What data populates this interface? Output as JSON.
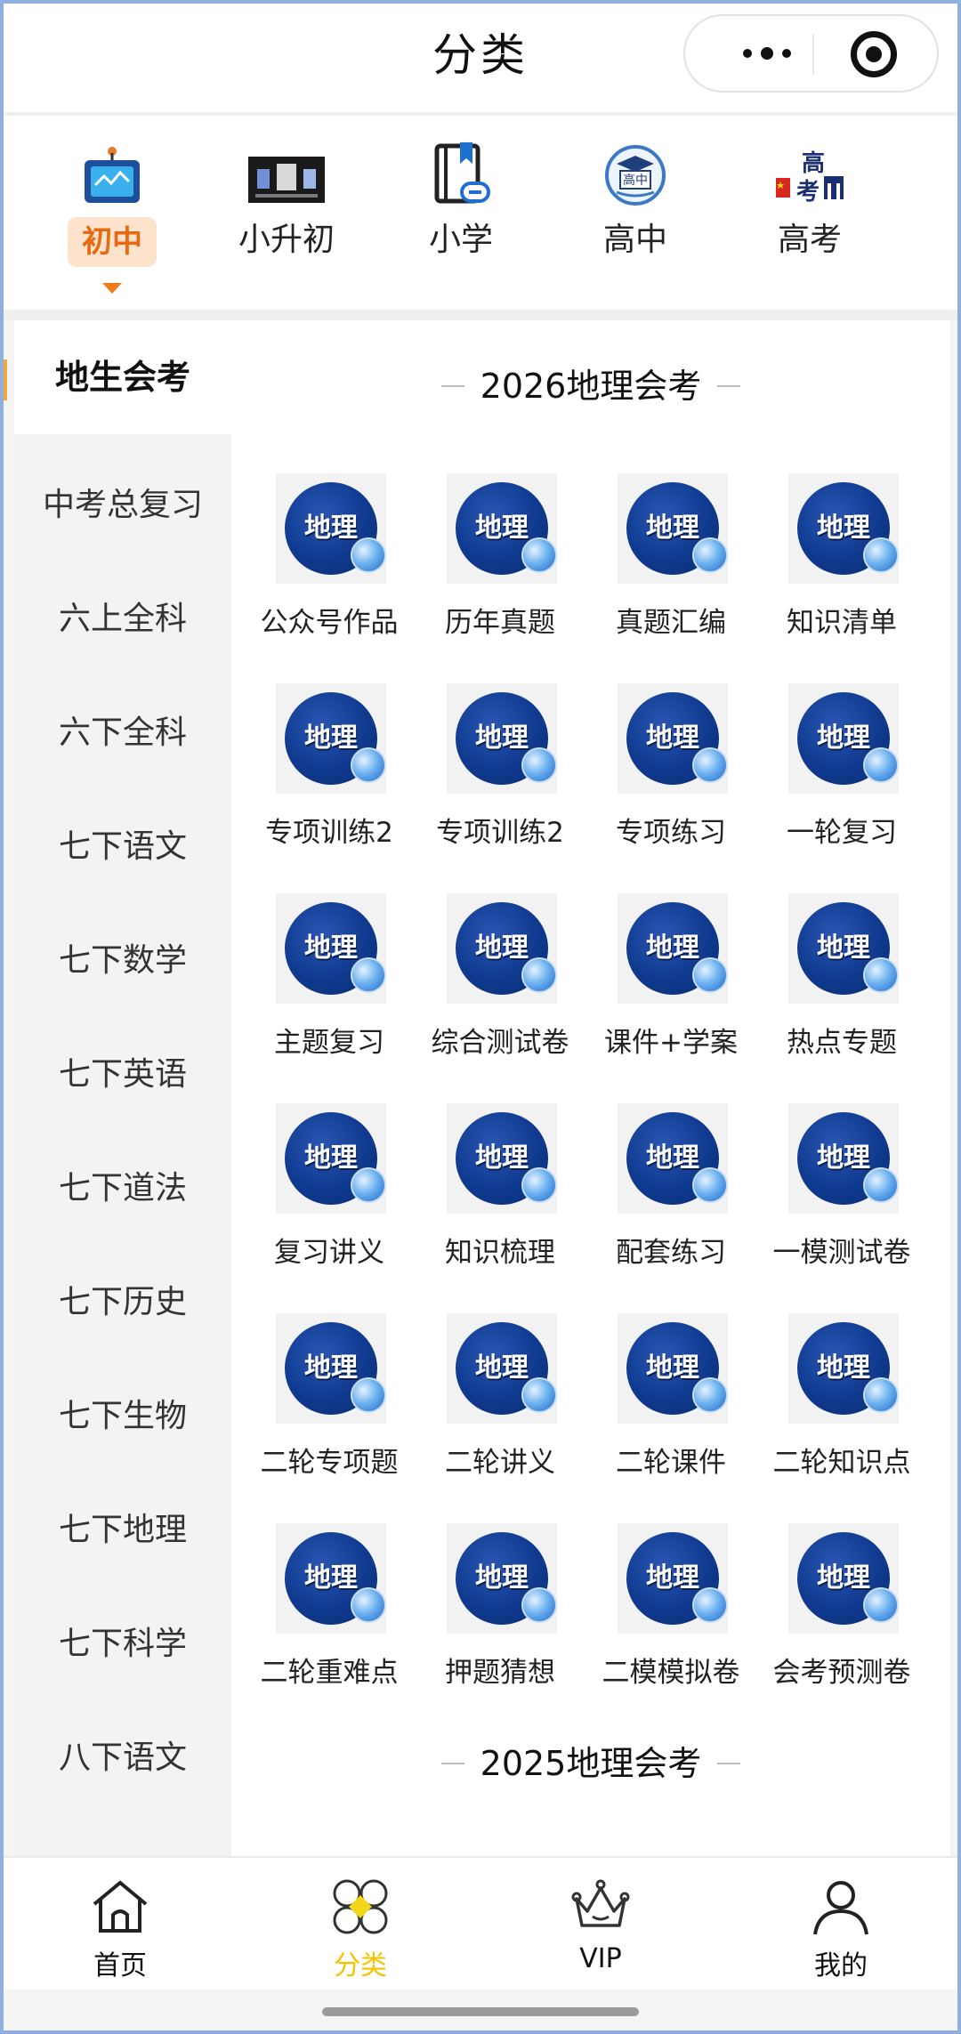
{
  "header": {
    "title": "分类"
  },
  "levels": [
    {
      "label": "初中",
      "icon": "tv-icon",
      "active": true
    },
    {
      "label": "小升初",
      "icon": "xiaoshengchu-banner-icon",
      "active": false
    },
    {
      "label": "小学",
      "icon": "book-icon",
      "active": false
    },
    {
      "label": "高中",
      "icon": "gaozhong-badge-icon",
      "active": false
    },
    {
      "label": "高考",
      "icon": "gaokao-icon",
      "active": false
    }
  ],
  "sidebar": {
    "items": [
      {
        "label": "地生会考",
        "active": true
      },
      {
        "label": "中考总复习"
      },
      {
        "label": "六上全科"
      },
      {
        "label": "六下全科"
      },
      {
        "label": "七下语文"
      },
      {
        "label": "七下数学"
      },
      {
        "label": "七下英语"
      },
      {
        "label": "七下道法"
      },
      {
        "label": "七下历史"
      },
      {
        "label": "七下生物"
      },
      {
        "label": "七下地理"
      },
      {
        "label": "七下科学"
      },
      {
        "label": "八下语文"
      }
    ]
  },
  "sections": [
    {
      "title": "2026地理会考",
      "icon_text": "地理",
      "items": [
        "公众号作品",
        "历年真题",
        "真题汇编",
        "知识清单",
        "专项训练2",
        "专项训练2",
        "专项练习",
        "一轮复习",
        "主题复习",
        "综合测试卷",
        "课件+学案",
        "热点专题",
        "复习讲义",
        "知识梳理",
        "配套练习",
        "一模测试卷",
        "二轮专项题",
        "二轮讲义",
        "二轮课件",
        "二轮知识点",
        "二轮重难点",
        "押题猜想",
        "二模模拟卷",
        "会考预测卷"
      ]
    },
    {
      "title": "2025地理会考"
    }
  ],
  "tabbar": {
    "tabs": [
      {
        "label": "首页",
        "icon": "home-icon"
      },
      {
        "label": "分类",
        "icon": "category-icon",
        "active": true
      },
      {
        "label": "VIP",
        "icon": "crown-icon"
      },
      {
        "label": "我的",
        "icon": "profile-icon"
      }
    ]
  },
  "colors": {
    "accent_orange": "#e56a12",
    "tab_active": "#f2c400",
    "subject_blue": "#0f3a8f"
  }
}
